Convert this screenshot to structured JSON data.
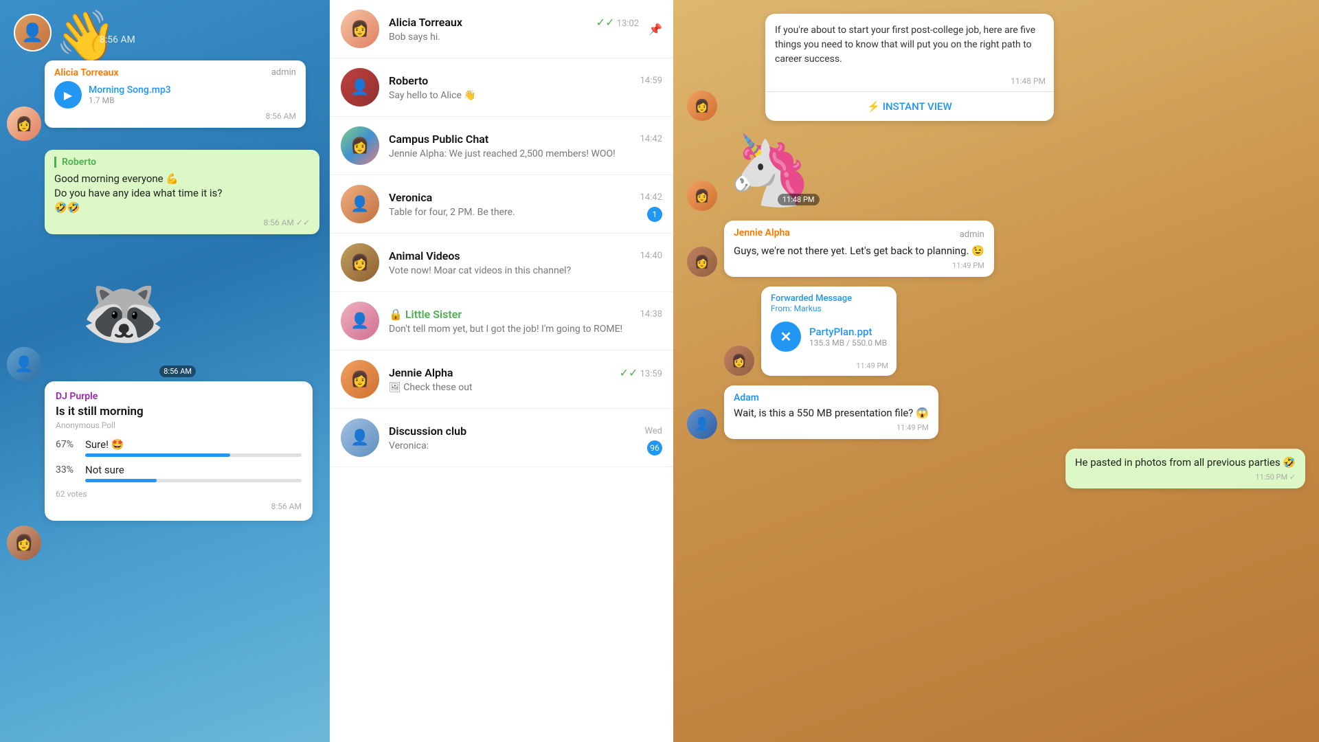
{
  "left": {
    "time_top": "8:56 AM",
    "wave_emoji": "👋",
    "audio_message": {
      "sender": "Alicia Torreaux",
      "admin": "admin",
      "title": "Morning Song.mp3",
      "size": "1.7 MB",
      "time": "8:56 AM"
    },
    "green_bubble": {
      "sender": "Roberto",
      "line1": "Good morning everyone 💪",
      "line2": "Do you have any idea what time it is?",
      "emoji": "🤣🤣",
      "time": "8:56 AM"
    },
    "sticker_time": "8:56 AM",
    "poll": {
      "sender": "DJ Purple",
      "question": "Is it still morning",
      "type": "Anonymous Poll",
      "option1_pct": "67%",
      "option1_label": "Sure! 🤩",
      "option1_width": "67%",
      "option2_pct": "33%",
      "option2_label": "Not sure",
      "option2_width": "33%",
      "votes": "62 votes",
      "time": "8:56 AM"
    }
  },
  "middle": {
    "chats": [
      {
        "name": "Alicia Torreaux",
        "time": "13:02",
        "preview": "Bob says hi.",
        "has_check": true,
        "has_pin": true,
        "avatar_class": "av-alicia",
        "avatar_emoji": ""
      },
      {
        "name": "Roberto",
        "time": "14:59",
        "preview": "Say hello to Alice 👋",
        "has_check": false,
        "avatar_class": "av-roberto",
        "avatar_emoji": ""
      },
      {
        "name": "Campus Public Chat",
        "time": "14:42",
        "preview": "Jennie Alpha: We just reached 2,500 members! WOO!",
        "avatar_class": "av-campus",
        "avatar_emoji": ""
      },
      {
        "name": "Veronica",
        "time": "14:42",
        "preview": "Table for four, 2 PM. Be there.",
        "badge": "1",
        "avatar_class": "av-veronica",
        "avatar_emoji": ""
      },
      {
        "name": "Animal Videos",
        "time": "14:40",
        "preview": "Vote now! Moar cat videos in this channel?",
        "avatar_class": "av-animal",
        "avatar_emoji": ""
      },
      {
        "name": "🔒 Little Sister",
        "time": "14:38",
        "preview": "Don't tell mom yet, but I got the job! I'm going to ROME!",
        "name_green": true,
        "avatar_class": "av-sister",
        "avatar_emoji": ""
      },
      {
        "name": "Jennie Alpha",
        "time": "13:59",
        "preview": "🖼 Check these out",
        "has_check": true,
        "avatar_class": "av-jennie",
        "avatar_emoji": ""
      },
      {
        "name": "Discussion club",
        "time": "Wed",
        "preview": "Veronica:",
        "badge": "96",
        "avatar_class": "av-discussion",
        "avatar_emoji": ""
      }
    ]
  },
  "right": {
    "article_text": "If you're about to start your first post-college job, here are five things you need to know that will put you on the right path to career success.",
    "article_time": "11:48 PM",
    "instant_view_label": "⚡ INSTANT VIEW",
    "unicorn_time": "11:48 PM",
    "jennie_msg": {
      "sender": "Jennie Alpha",
      "admin": "admin",
      "text": "Guys, we're not there yet. Let's get back to planning. 😉",
      "time": "11:49 PM"
    },
    "forwarded": {
      "label": "Forwarded Message",
      "from": "From: Markus",
      "file_name": "PartyPlan.ppt",
      "file_size": "135.3 MB / 550.0 MB",
      "time": "11:49 PM"
    },
    "adam_msg": {
      "sender": "Adam",
      "text": "Wait, is this a 550 MB presentation file? 😱",
      "time": "11:49 PM"
    },
    "green_msg": {
      "text": "He pasted in photos from all previous parties 🤣",
      "time": "11:50 PM ✓"
    }
  }
}
